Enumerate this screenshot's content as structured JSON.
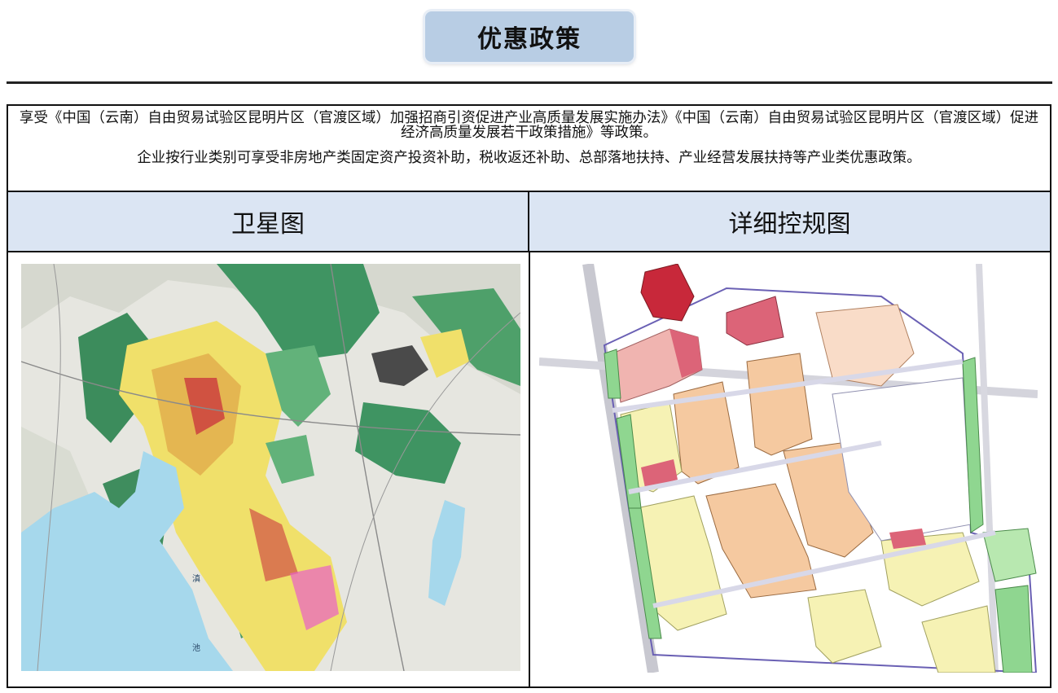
{
  "header": {
    "title": "优惠政策"
  },
  "intro": {
    "line1": "享受《中国（云南）自由贸易试验区昆明片区（官渡区域）加强招商引资促进产业高质量发展实施办法》《中国（云南）自由贸易试验区昆明片区（官渡区域）促进经济高质量发展若干政策措施》等政策。",
    "line2": "企业按行业类别可享受非房地产类固定资产投资补助，税收返还补助、总部落地扶持、产业经营发展扶持等产业类优惠政策。"
  },
  "columns": {
    "left": {
      "title": "卫星图"
    },
    "right": {
      "title": "详细控规图"
    }
  },
  "satellite_map": {
    "lake_label_1": "滇",
    "lake_label_2": "池"
  },
  "colors": {
    "header_bg": "#b8cde4",
    "column_header_bg": "#dbe5f3",
    "lake": "#a6d8ec",
    "forest": "#3f9462",
    "urban": "#f0e06a",
    "commercial": "#c8283a",
    "residential": "#f5c9a0",
    "industrial": "#f6f2b4",
    "green_space": "#8fd690"
  }
}
